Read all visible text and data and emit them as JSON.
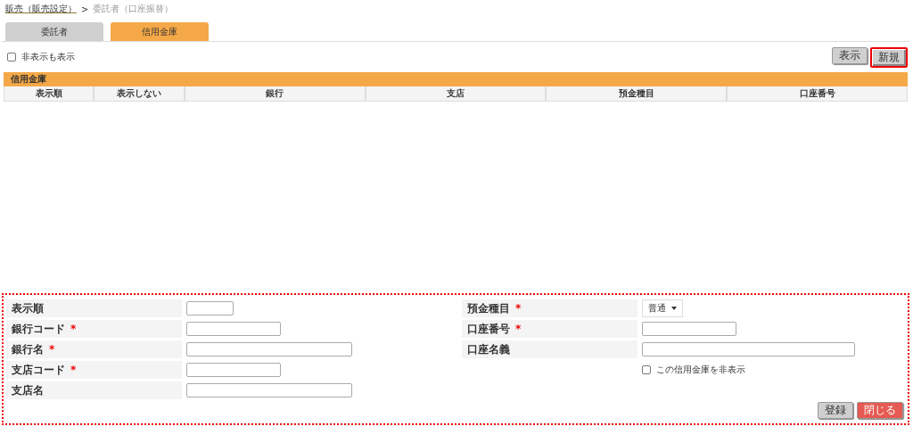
{
  "breadcrumb": {
    "link": "販売（販売設定）",
    "separator": ">",
    "current": "委託者（口座振替）"
  },
  "tabs": [
    {
      "label": "委託者",
      "selected": false
    },
    {
      "label": "信用金庫",
      "selected": true
    }
  ],
  "show_hidden": {
    "label": "非表示も表示",
    "checked": false
  },
  "toolbar_buttons": [
    {
      "label": "表示",
      "highlighted": false
    },
    {
      "label": "新規",
      "highlighted": true
    }
  ],
  "table": {
    "title": "信用金庫",
    "columns": [
      "表示順",
      "表示しない",
      "銀行",
      "支店",
      "預金種目",
      "口座番号"
    ]
  },
  "form": {
    "left": [
      {
        "label": "表示順",
        "required": false,
        "kind": "short"
      },
      {
        "label": "銀行コード",
        "required": true,
        "kind": "medium"
      },
      {
        "label": "銀行名",
        "required": true,
        "kind": "long"
      },
      {
        "label": "支店コード",
        "required": true,
        "kind": "medium"
      },
      {
        "label": "支店名",
        "required": false,
        "kind": "long"
      }
    ],
    "right": [
      {
        "label": "預金種目",
        "required": true,
        "kind": "select",
        "value": "普通"
      },
      {
        "label": "口座番号",
        "required": true,
        "kind": "medium"
      },
      {
        "label": "口座名義",
        "required": false,
        "kind": "wide"
      },
      {
        "kind": "checkbox",
        "option": "この信用金庫を非表示",
        "checked": false
      }
    ],
    "required_mark": "*",
    "buttons": [
      {
        "label": "登録",
        "kind": "secondary"
      },
      {
        "label": "閉じる",
        "kind": "danger"
      }
    ]
  }
}
